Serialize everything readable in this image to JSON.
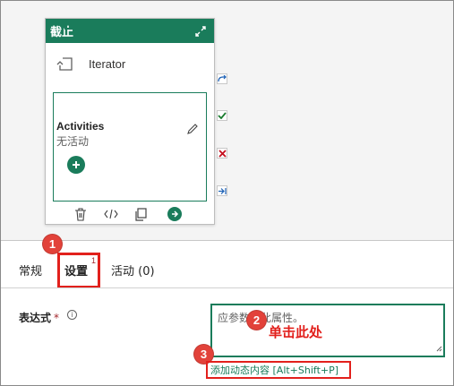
{
  "card": {
    "title": "截止",
    "iterator_label": "Iterator",
    "activities_title": "Activities",
    "activities_empty": "无活动"
  },
  "tabs": [
    {
      "label": "常规"
    },
    {
      "label": "设置",
      "superscript": "1",
      "active": true
    },
    {
      "label": "活动 (0)"
    }
  ],
  "badges": [
    "1",
    "2",
    "3"
  ],
  "expression": {
    "label": "表达式",
    "required_mark": "*",
    "info_glyph": "i",
    "value": "应参数化此属性。"
  },
  "annotation": "单击此处",
  "dynamic_link": "添加动态内容 [Alt+Shift+P]",
  "colors": {
    "accent": "#1a7c5b",
    "highlight": "#e2201c",
    "badge": "#e2423a"
  },
  "icons": {
    "header": "expand-icon",
    "iterator": "iterator-icon",
    "edit": "pencil-icon",
    "add": "plus-icon",
    "toolbar": [
      "delete-icon",
      "code-icon",
      "copy-icon",
      "go-icon"
    ],
    "ports": [
      "skip-port-icon",
      "success-port-icon",
      "failure-port-icon",
      "completion-port-icon"
    ]
  }
}
